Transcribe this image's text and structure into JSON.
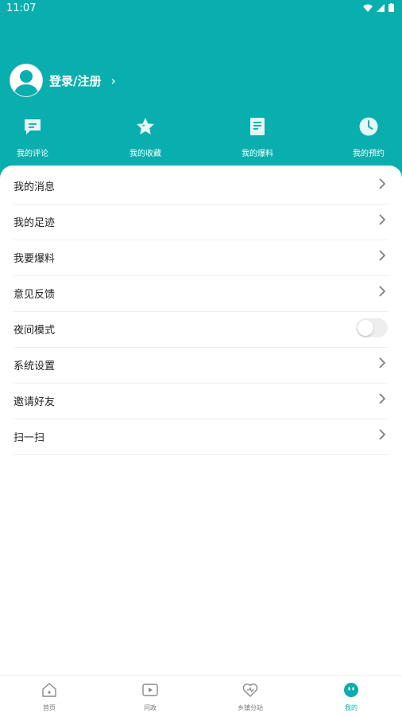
{
  "status_bar": {
    "time": "11:07"
  },
  "profile": {
    "login_label": "登录/注册",
    "chevron": "›"
  },
  "shortcuts": [
    {
      "label": "我的评论",
      "icon": "comment-icon"
    },
    {
      "label": "我的收藏",
      "icon": "star-icon"
    },
    {
      "label": "我的爆料",
      "icon": "document-icon"
    },
    {
      "label": "我的预约",
      "icon": "clock-icon"
    }
  ],
  "menu": [
    {
      "label": "我的消息"
    },
    {
      "label": "我的足迹"
    },
    {
      "label": "我要爆料"
    },
    {
      "label": "意见反馈"
    },
    {
      "label": "夜间模式",
      "toggle": false
    },
    {
      "label": "系统设置"
    },
    {
      "label": "邀请好友"
    },
    {
      "label": "扫一扫"
    }
  ],
  "tabbar": [
    {
      "label": "首页",
      "icon": "home-icon",
      "active": false
    },
    {
      "label": "问政",
      "icon": "video-play-icon",
      "active": false
    },
    {
      "label": "乡镇分站",
      "icon": "heart-icon",
      "active": false
    },
    {
      "label": "我的",
      "icon": "user-face-icon",
      "active": true
    }
  ],
  "colors": {
    "accent": "#09aeae",
    "icon_light": "#e6f7f7"
  }
}
